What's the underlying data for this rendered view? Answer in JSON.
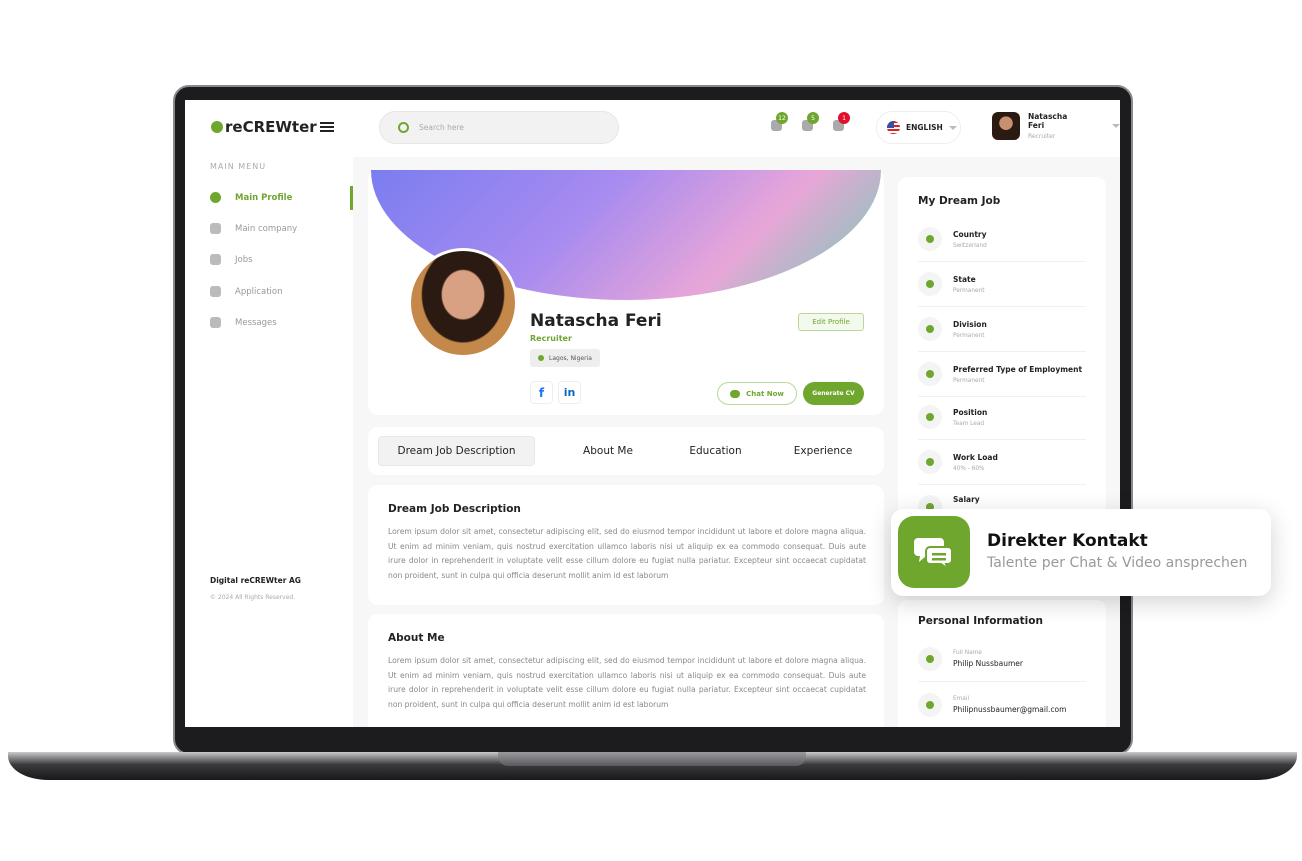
{
  "brand": {
    "logo_small": "Digital",
    "logo": "reCREWter",
    "accent": "#6fa62e"
  },
  "sidebar": {
    "section": "MAIN MENU",
    "items": [
      {
        "label": "Main Profile",
        "icon": "user-icon",
        "active": true
      },
      {
        "label": "Main company",
        "icon": "building-icon"
      },
      {
        "label": "Jobs",
        "icon": "briefcase-icon"
      },
      {
        "label": "Application",
        "icon": "application-icon"
      },
      {
        "label": "Messages",
        "icon": "message-icon"
      }
    ],
    "footer_company": "Digital reCREWter AG",
    "footer_copy": "© 2024 All Rights Reserved."
  },
  "topbar": {
    "search_placeholder": "Search here",
    "notifications": [
      {
        "icon": "bell-icon",
        "count": "12",
        "color": "#6fa62e"
      },
      {
        "icon": "inbox-icon",
        "count": "5",
        "color": "#6fa62e"
      },
      {
        "icon": "gear-icon",
        "count": "1",
        "color": "#e0102a"
      }
    ],
    "language": "ENGLISH",
    "user_name": "Natascha Feri",
    "user_role": "Recruiter"
  },
  "profile": {
    "name": "Natascha Feri",
    "role": "Recruiter",
    "location": "Lagos, Nigeria",
    "edit": "Edit Profile",
    "chat": "Chat Now",
    "generate": "Generate CV",
    "facebook": "f",
    "linkedin": "in"
  },
  "tabs": [
    "Dream Job Description",
    "About Me",
    "Education",
    "Experience"
  ],
  "sections": [
    {
      "title": "Dream Job Description",
      "text": "Lorem ipsum dolor sit amet, consectetur adipiscing elit, sed do eiusmod tempor incididunt ut labore et dolore magna aliqua. Ut enim ad minim veniam, quis nostrud exercitation ullamco laboris nisi ut aliquip ex ea commodo consequat. Duis aute irure dolor in reprehenderit in voluptate velit esse cillum dolore eu fugiat nulla pariatur. Excepteur sint occaecat cupidatat non proident, sunt in culpa qui officia deserunt mollit anim id est laborum"
    },
    {
      "title": "About Me",
      "text": "Lorem ipsum dolor sit amet, consectetur adipiscing elit, sed do eiusmod tempor incididunt ut labore et dolore magna aliqua. Ut enim ad minim veniam, quis nostrud exercitation ullamco laboris nisi ut aliquip ex ea commodo consequat. Duis aute irure dolor in reprehenderit in voluptate velit esse cillum dolore eu fugiat nulla pariatur. Excepteur sint occaecat cupidatat non proident, sunt in culpa qui officia deserunt mollit anim id est laborum"
    }
  ],
  "dream_job": {
    "title": "My Dream Job",
    "items": [
      {
        "label": "Country",
        "value": "Switzerland"
      },
      {
        "label": "State",
        "value": "Permanent"
      },
      {
        "label": "Division",
        "value": "Permanent"
      },
      {
        "label": "Preferred Type of Employment",
        "value": "Permanent"
      },
      {
        "label": "Position",
        "value": "Team Lead"
      },
      {
        "label": "Work Load",
        "value": "40% - 60%"
      },
      {
        "label": "Salary"
      }
    ]
  },
  "personal": {
    "title": "Personal Information",
    "items": [
      {
        "label": "Full Name",
        "value": "Philip Nussbaumer"
      },
      {
        "label": "Email",
        "value": "Philipnussbaumer@gmail.com"
      }
    ]
  },
  "popup": {
    "title": "Direkter Kontakt",
    "subtitle": "Talente per Chat & Video ansprechen"
  }
}
